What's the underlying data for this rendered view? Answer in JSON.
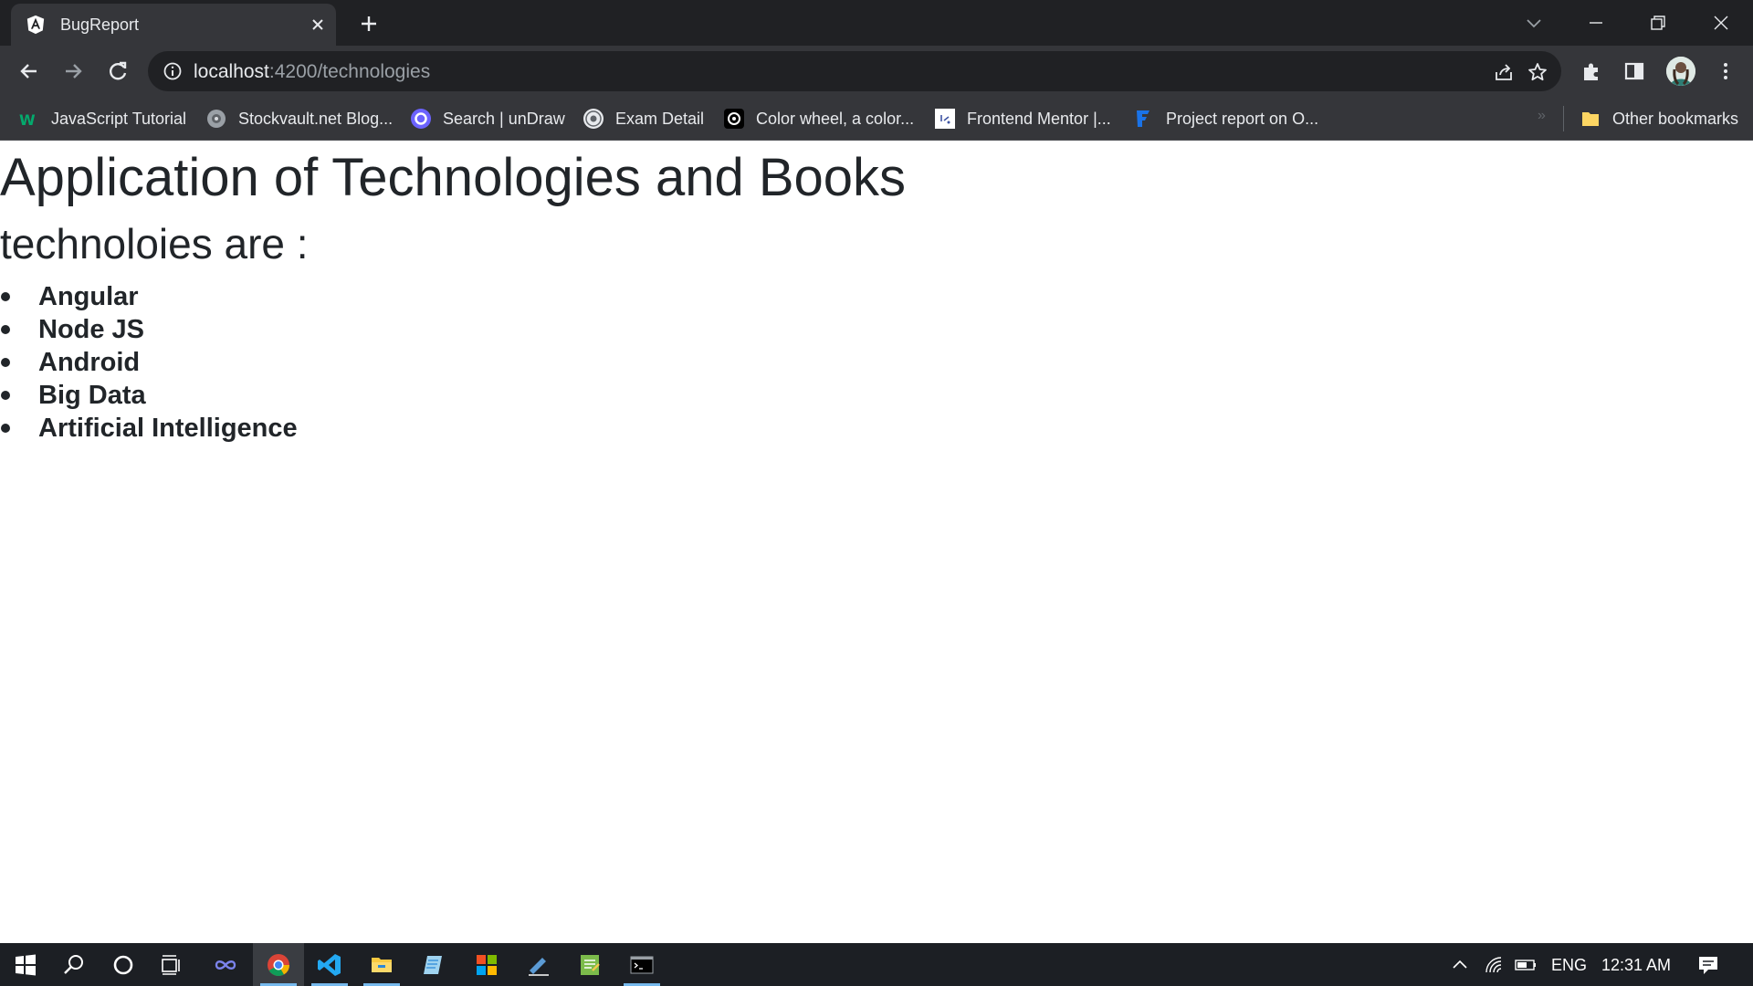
{
  "browser": {
    "tab_title": "BugReport",
    "url_host": "localhost",
    "url_rest": ":4200/technologies"
  },
  "bookmarks": [
    {
      "label": "JavaScript Tutorial",
      "icon": "w3schools-icon"
    },
    {
      "label": "Stockvault.net Blog...",
      "icon": "stockvault-icon"
    },
    {
      "label": "Search | unDraw",
      "icon": "undraw-icon"
    },
    {
      "label": "Exam Detail",
      "icon": "exam-icon"
    },
    {
      "label": "Color wheel, a color...",
      "icon": "canva-icon"
    },
    {
      "label": "Frontend Mentor |...",
      "icon": "frontend-mentor-icon"
    },
    {
      "label": "Project report on O...",
      "icon": "project-report-icon"
    }
  ],
  "other_bookmarks": "Other bookmarks",
  "page": {
    "title": "Application of Technologies and Books",
    "subtitle": "technoloies are :",
    "technologies": [
      "Angular",
      "Node JS",
      "Android",
      "Big Data",
      "Artificial Intelligence"
    ]
  },
  "taskbar": {
    "language": "ENG",
    "time": "12:31 AM"
  }
}
